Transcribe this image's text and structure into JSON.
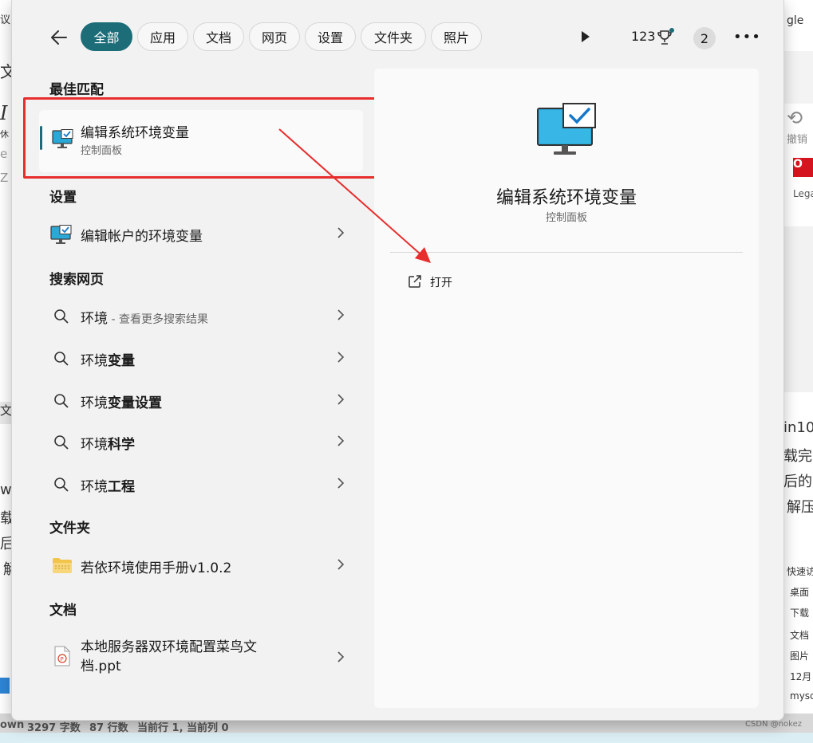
{
  "background": {
    "left_fragments": [
      "议",
      "文",
      "I",
      "休",
      "e",
      "Z",
      "文",
      "wi",
      "载",
      "后",
      "解"
    ],
    "right_fragments": {
      "top_text": "gle",
      "undo_label": "撤销",
      "legal_text": "Lega",
      "article_lines": [
        "in10",
        "载完",
        "后的",
        "解压"
      ],
      "explorer_items": [
        "快速访",
        "桌面",
        "下载",
        "文档",
        "图片",
        "12月",
        "mysc"
      ]
    },
    "status_bar": {
      "mode": "own",
      "chars": "3297 字数",
      "lines": "87 行数",
      "cursor": "当前行 1, 当前列 0"
    },
    "watermark": "CSDN @nokez"
  },
  "header": {
    "tabs": [
      "全部",
      "应用",
      "文档",
      "网页",
      "设置",
      "文件夹",
      "照片"
    ],
    "active_tab": "全部",
    "points": "123",
    "badge": "2",
    "accent_color": "#1c6d78"
  },
  "results": {
    "best_match_title": "最佳匹配",
    "best_match": {
      "title": "编辑系统环境变量",
      "subtitle": "控制面板",
      "icon": "monitor-check-icon"
    },
    "settings_title": "设置",
    "settings_items": [
      {
        "label": "编辑帐户的环境变量",
        "icon": "monitor-check-icon"
      }
    ],
    "web_title": "搜索网页",
    "web_items": [
      {
        "prefix": "环境",
        "bold": "",
        "hint": " - 查看更多搜索结果"
      },
      {
        "prefix": "环境",
        "bold": "变量",
        "hint": ""
      },
      {
        "prefix": "环境",
        "bold": "变量设置",
        "hint": ""
      },
      {
        "prefix": "环境",
        "bold": "科学",
        "hint": ""
      },
      {
        "prefix": "环境",
        "bold": "工程",
        "hint": ""
      }
    ],
    "folder_title": "文件夹",
    "folder_item": {
      "label": "若依环境使用手册v1.0.2",
      "icon": "zip-folder-icon"
    },
    "doc_title": "文档",
    "doc_item": {
      "line1": "本地服务器双环境配置菜鸟文",
      "line2": "档.ppt",
      "icon": "ppt-file-icon"
    }
  },
  "detail": {
    "title": "编辑系统环境变量",
    "subtitle": "控制面板",
    "action_label": "打开",
    "icon": "monitor-check-icon"
  },
  "annotation_color": "#e82d2d"
}
